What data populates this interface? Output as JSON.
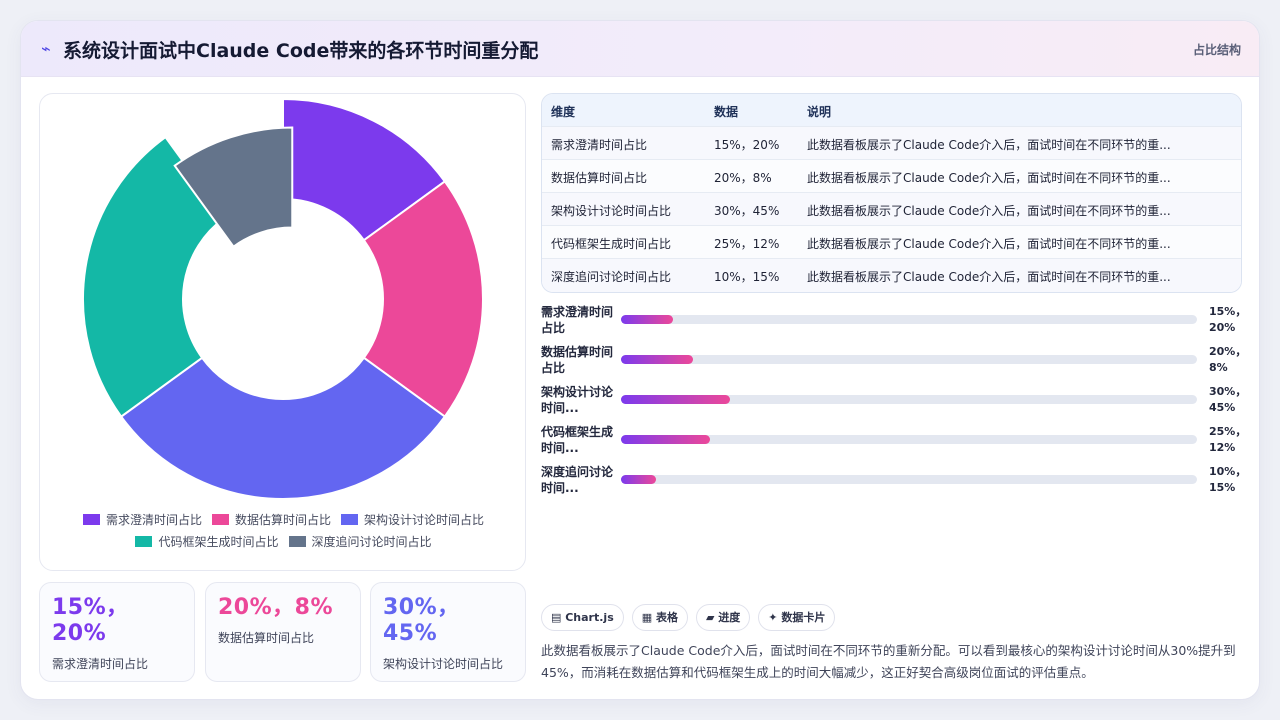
{
  "header": {
    "title": "系统设计面试中Claude Code带来的各环节时间重分配",
    "tag": "占比结构"
  },
  "chart_data": {
    "type": "pie",
    "title": "",
    "categories": [
      "需求澄清时间占比",
      "数据估算时间占比",
      "架构设计讨论时间占比",
      "代码框架生成时间占比",
      "深度追问讨论时间占比"
    ],
    "values": [
      15,
      20,
      30,
      25,
      10
    ],
    "colors": [
      "#7c3aed",
      "#ec4899",
      "#6366f1",
      "#14b8a6",
      "#64748b"
    ],
    "legend_position": "bottom"
  },
  "stats": [
    {
      "value_line1": "15%，",
      "value_line2": "20%",
      "label": "需求澄清时间占比",
      "color": "#7c3aed"
    },
    {
      "value_line1": "20%，8%",
      "value_line2": "",
      "label": "数据估算时间占比",
      "color": "#ec4899"
    },
    {
      "value_line1": "30%，",
      "value_line2": "45%",
      "label": "架构设计讨论时间占比",
      "color": "#6366f1"
    }
  ],
  "table": {
    "headers": [
      "维度",
      "数据",
      "说明"
    ],
    "rows": [
      {
        "dim": "需求澄清时间占比",
        "data": "15%，20%",
        "note": "此数据看板展示了Claude Code介入后，面试时间在不同环节的重..."
      },
      {
        "dim": "数据估算时间占比",
        "data": "20%，8%",
        "note": "此数据看板展示了Claude Code介入后，面试时间在不同环节的重..."
      },
      {
        "dim": "架构设计讨论时间占比",
        "data": "30%，45%",
        "note": "此数据看板展示了Claude Code介入后，面试时间在不同环节的重..."
      },
      {
        "dim": "代码框架生成时间占比",
        "data": "25%，12%",
        "note": "此数据看板展示了Claude Code介入后，面试时间在不同环节的重..."
      },
      {
        "dim": "深度追问讨论时间占比",
        "data": "10%，15%",
        "note": "此数据看板展示了Claude Code介入后，面试时间在不同环节的重..."
      }
    ]
  },
  "progress": [
    {
      "name_line1": "需求澄清时间",
      "name_line2": "占比",
      "val_line1": "15%，",
      "val_line2": "20%",
      "progress": 0.09
    },
    {
      "name_line1": "数据估算时间",
      "name_line2": "占比",
      "val_line1": "20%，",
      "val_line2": "8%",
      "progress": 0.125
    },
    {
      "name_line1": "架构设计讨论",
      "name_line2": "时间...",
      "val_line1": "30%，",
      "val_line2": "45%",
      "progress": 0.19
    },
    {
      "name_line1": "代码框架生成",
      "name_line2": "时间...",
      "val_line1": "25%，",
      "val_line2": "12%",
      "progress": 0.155
    },
    {
      "name_line1": "深度追问讨论",
      "name_line2": "时间...",
      "val_line1": "10%，",
      "val_line2": "15%",
      "progress": 0.06
    }
  ],
  "chips": [
    {
      "icon": "▤",
      "label": "Chart.js"
    },
    {
      "icon": "▦",
      "label": "表格"
    },
    {
      "icon": "▰",
      "label": "进度"
    },
    {
      "icon": "✦",
      "label": "数据卡片"
    }
  ],
  "description": "此数据看板展示了Claude Code介入后，面试时间在不同环节的重新分配。可以看到最核心的架构设计讨论时间从30%提升到45%，而消耗在数据估算和代码框架生成上的时间大幅减少，这正好契合高级岗位面试的评估重点。"
}
